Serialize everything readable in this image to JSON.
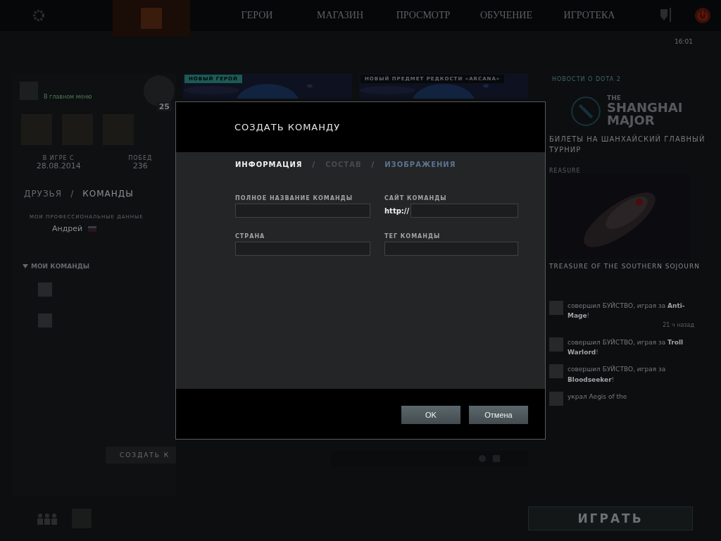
{
  "top_nav": {
    "items": [
      {
        "label": "ГЕРОИ",
        "selected": false
      },
      {
        "label": "МАГАЗИН",
        "selected": false
      },
      {
        "label": "ПРОСМОТР",
        "selected": false
      },
      {
        "label": "ОБУЧЕНИЕ",
        "selected": false
      },
      {
        "label": "ИГРОТЕКА",
        "selected": false
      }
    ],
    "time": "16:01"
  },
  "profile": {
    "status": "В главном меню",
    "level": "25",
    "stats": [
      {
        "label": "В ИГРЕ С",
        "value": "28.08.2014"
      },
      {
        "label": "ПОБЕД",
        "value": "236"
      }
    ]
  },
  "social_tabs": [
    {
      "label": "ДРУЗЬЯ",
      "selected": false
    },
    {
      "separator": "/",
      "label": "КОМАНДЫ",
      "selected": true
    }
  ],
  "pro_data": {
    "label": "МОИ ПРОФЕССИОНАЛЬНЫЕ ДАННЫЕ",
    "name": "Андрей"
  },
  "my_teams": {
    "label": "МОИ КОМАНДЫ",
    "expanded": true
  },
  "create_button": "СОЗДАТЬ К",
  "banners": [
    {
      "tag": "НОВЫЙ ГЕРОЙ"
    },
    {
      "tag": "НОВЫЙ ПРЕДМЕТ РЕДКОСТИ «ARCANA»"
    }
  ],
  "news": {
    "title": "НОВОСТИ О DOTA 2",
    "logo": [
      "THE",
      "SHANGHAI",
      "MAJOR"
    ],
    "headline": "БИЛЕТЫ НА ШАНХАЙСКИЙ ГЛАВНЫЙ ТУРНИР"
  },
  "treasure": {
    "label": "REASURE",
    "title": "TREASURE OF THE SOUTHERN SOJOURN"
  },
  "feed": [
    {
      "text": "совершил БУЙСТВО, играя за **Anti-Mage**!",
      "time": "21 ч назад"
    },
    {
      "text": "совершил БУЙСТВО, играя за **Troll Warlord**!"
    },
    {
      "text": "совершил БУЙСТВО, играя за **Bloodseeker**!"
    },
    {
      "text": "украл Aegis of the"
    }
  ],
  "play_button": "ИГРАТЬ",
  "modal": {
    "title": "СОЗДАТЬ КОМАНДУ",
    "tabs": [
      {
        "label": "ИНФОРМАЦИЯ",
        "selected": true,
        "disabled": false
      },
      {
        "separator": "/",
        "label": "СОСТАВ",
        "selected": false,
        "disabled": true
      },
      {
        "separator": "/",
        "label": "ИЗОБРАЖЕНИЯ",
        "selected": false,
        "disabled": false
      }
    ],
    "fields": [
      {
        "label": "ПОЛНОЕ НАЗВАНИЕ КОМАНДЫ"
      },
      {
        "label": "САЙТ КОМАНДЫ",
        "prefix": "http://"
      },
      {
        "label": "СТРАНА"
      },
      {
        "label": "ТЕГ КОМАНДЫ"
      }
    ],
    "buttons": [
      "OK",
      "Отмена"
    ]
  }
}
